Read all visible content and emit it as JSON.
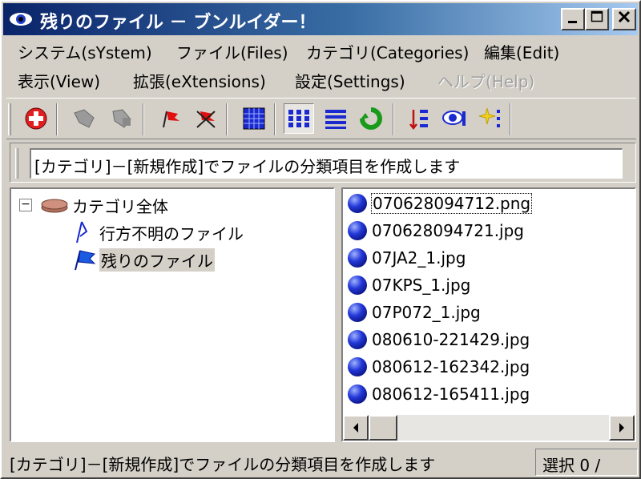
{
  "window": {
    "title": "残りのファイル － ブンルイダー！"
  },
  "menu": {
    "row1": [
      "システム(sYstem)",
      "ファイル(Files)",
      "カテゴリ(Categories)",
      "編集(Edit)"
    ],
    "row2": [
      "表示(View)",
      "拡張(eXtensions)",
      "設定(Settings)",
      "ヘルプ(Help)"
    ]
  },
  "hint": {
    "text": "[カテゴリ]－[新規作成]でファイルの分類項目を作成します"
  },
  "tree": {
    "root": "カテゴリ全体",
    "items": [
      "行方不明のファイル",
      "残りのファイル"
    ]
  },
  "files": [
    "070628094712.png",
    "070628094721.jpg",
    "07JA2_1.jpg",
    "07KPS_1.jpg",
    "07P072_1.jpg",
    "080610-221429.jpg",
    "080612-162342.jpg",
    "080612-165411.jpg"
  ],
  "status": {
    "text": "[カテゴリ]－[新規作成]でファイルの分類項目を作成します",
    "selection": "選択 0 /"
  },
  "colors": {
    "titlebar_start": "#0a246a",
    "titlebar_end": "#a6caf0",
    "face": "#d4d0c8"
  }
}
